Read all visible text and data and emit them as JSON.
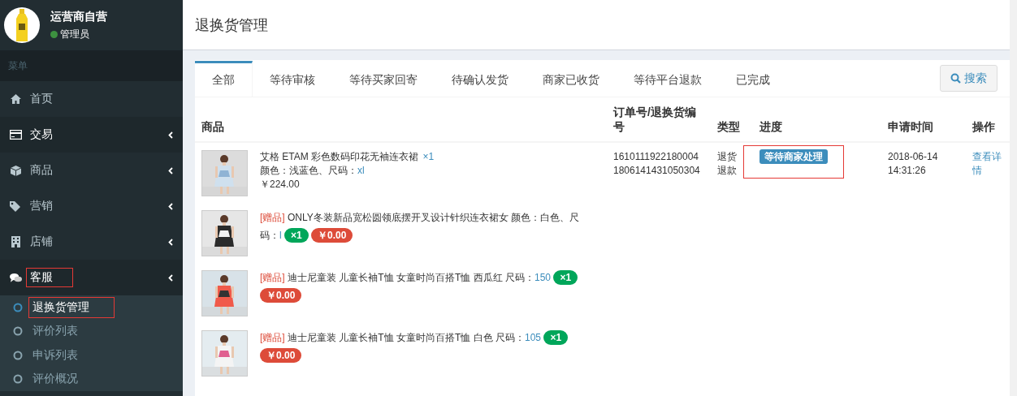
{
  "sidebar": {
    "user": {
      "name": "运营商自营",
      "role": "管理员",
      "online": true
    },
    "menu_label": "菜单",
    "items": [
      {
        "label": "首页",
        "active": false,
        "has_children": false,
        "annotated": false
      },
      {
        "label": "交易",
        "active": true,
        "has_children": true,
        "annotated": false
      },
      {
        "label": "商品",
        "active": false,
        "has_children": true,
        "annotated": false
      },
      {
        "label": "营销",
        "active": false,
        "has_children": true,
        "annotated": false
      },
      {
        "label": "店铺",
        "active": false,
        "has_children": true,
        "annotated": false
      },
      {
        "label": "客服",
        "active": true,
        "has_children": true,
        "annotated": true
      }
    ],
    "subitems": [
      {
        "label": "退换货管理",
        "selected": true,
        "annotated": true
      },
      {
        "label": "评价列表",
        "selected": false,
        "annotated": false
      },
      {
        "label": "申诉列表",
        "selected": false,
        "annotated": false
      },
      {
        "label": "评价概况",
        "selected": false,
        "annotated": false
      }
    ]
  },
  "page_title": "退换货管理",
  "tabs": [
    {
      "label": "全部",
      "selected": true
    },
    {
      "label": "等待审核",
      "selected": false
    },
    {
      "label": "等待买家回寄",
      "selected": false
    },
    {
      "label": "待确认发货",
      "selected": false
    },
    {
      "label": "商家已收货",
      "selected": false
    },
    {
      "label": "等待平台退款",
      "selected": false
    },
    {
      "label": "已完成",
      "selected": false
    }
  ],
  "search_button": "搜索",
  "table": {
    "columns": [
      "商品",
      "订单号/退换货编号",
      "类型",
      "进度",
      "申请时间",
      "操作"
    ],
    "rows": [
      {
        "products": [
          {
            "kind": "main",
            "name": "艾格 ETAM 彩色数码印花无袖连衣裙",
            "quantity": "×1",
            "spec_label": "颜色：浅蓝色、尺码：",
            "spec_value": "xl",
            "price": "￥224.00"
          },
          {
            "kind": "gift",
            "gift_tag": "[赠品]",
            "name": "ONLY冬装新品宽松圆领底摆开叉设计针织连衣裙女",
            "spec_label": "颜色：白色、尺码：",
            "spec_value": "l",
            "quantity": "×1",
            "price": "￥0.00"
          },
          {
            "kind": "gift",
            "gift_tag": "[赠品]",
            "name": "迪士尼童装 儿童长袖T恤 女童时尚百搭T恤 西瓜红",
            "spec_label": "尺码：",
            "spec_value": "150",
            "quantity": "×1",
            "price": "￥0.00"
          },
          {
            "kind": "gift",
            "gift_tag": "[赠品]",
            "name": "迪士尼童装 儿童长袖T恤 女童时尚百搭T恤 白色",
            "spec_label": "尺码：",
            "spec_value": "105",
            "quantity": "×1",
            "price": "￥0.00"
          }
        ],
        "order_no": "1610111922180004",
        "return_no": "1806141431050304",
        "type": "退货退款",
        "status": "等待商家处理",
        "status_annotated": true,
        "date": "2018-06-14",
        "time": "14:31:26",
        "action": "查看详情"
      }
    ]
  }
}
